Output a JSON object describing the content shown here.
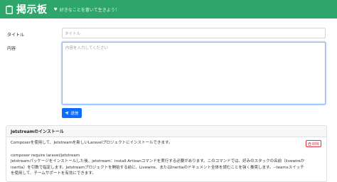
{
  "header": {
    "brand": "掲示板",
    "tagline": "好きなことを書いて生きよう！",
    "colors": {
      "background": "#2ea56b"
    }
  },
  "form": {
    "title_label": "タイトル",
    "title_placeholder": "タイトル",
    "content_label": "内容",
    "content_placeholder": "内容を入力してください",
    "submit_label": "送信"
  },
  "posts": [
    {
      "title": "Jetstreamのインストール",
      "delete_label": "削除",
      "lines": [
        "Composerを使用して、Jetstreamを新しいLaravelプロジェクトにインストールできます。",
        "",
        "composer require laravel/jetstream",
        "Jetstreamパッケージをインストールした後、jetstream：install Artisanコマンドを実行する必要があります。このコマンドでは、好みのスタックの名前（livewireか",
        "inertia）を引数で指定します。Jetstreamプロジェクトを開始する前に、Livewire、またはInertiaのドキュメント全体を読むことを強く推奨します。--teamsスイッチ",
        "を使用して、チームサポートを有効にできます。"
      ]
    }
  ]
}
